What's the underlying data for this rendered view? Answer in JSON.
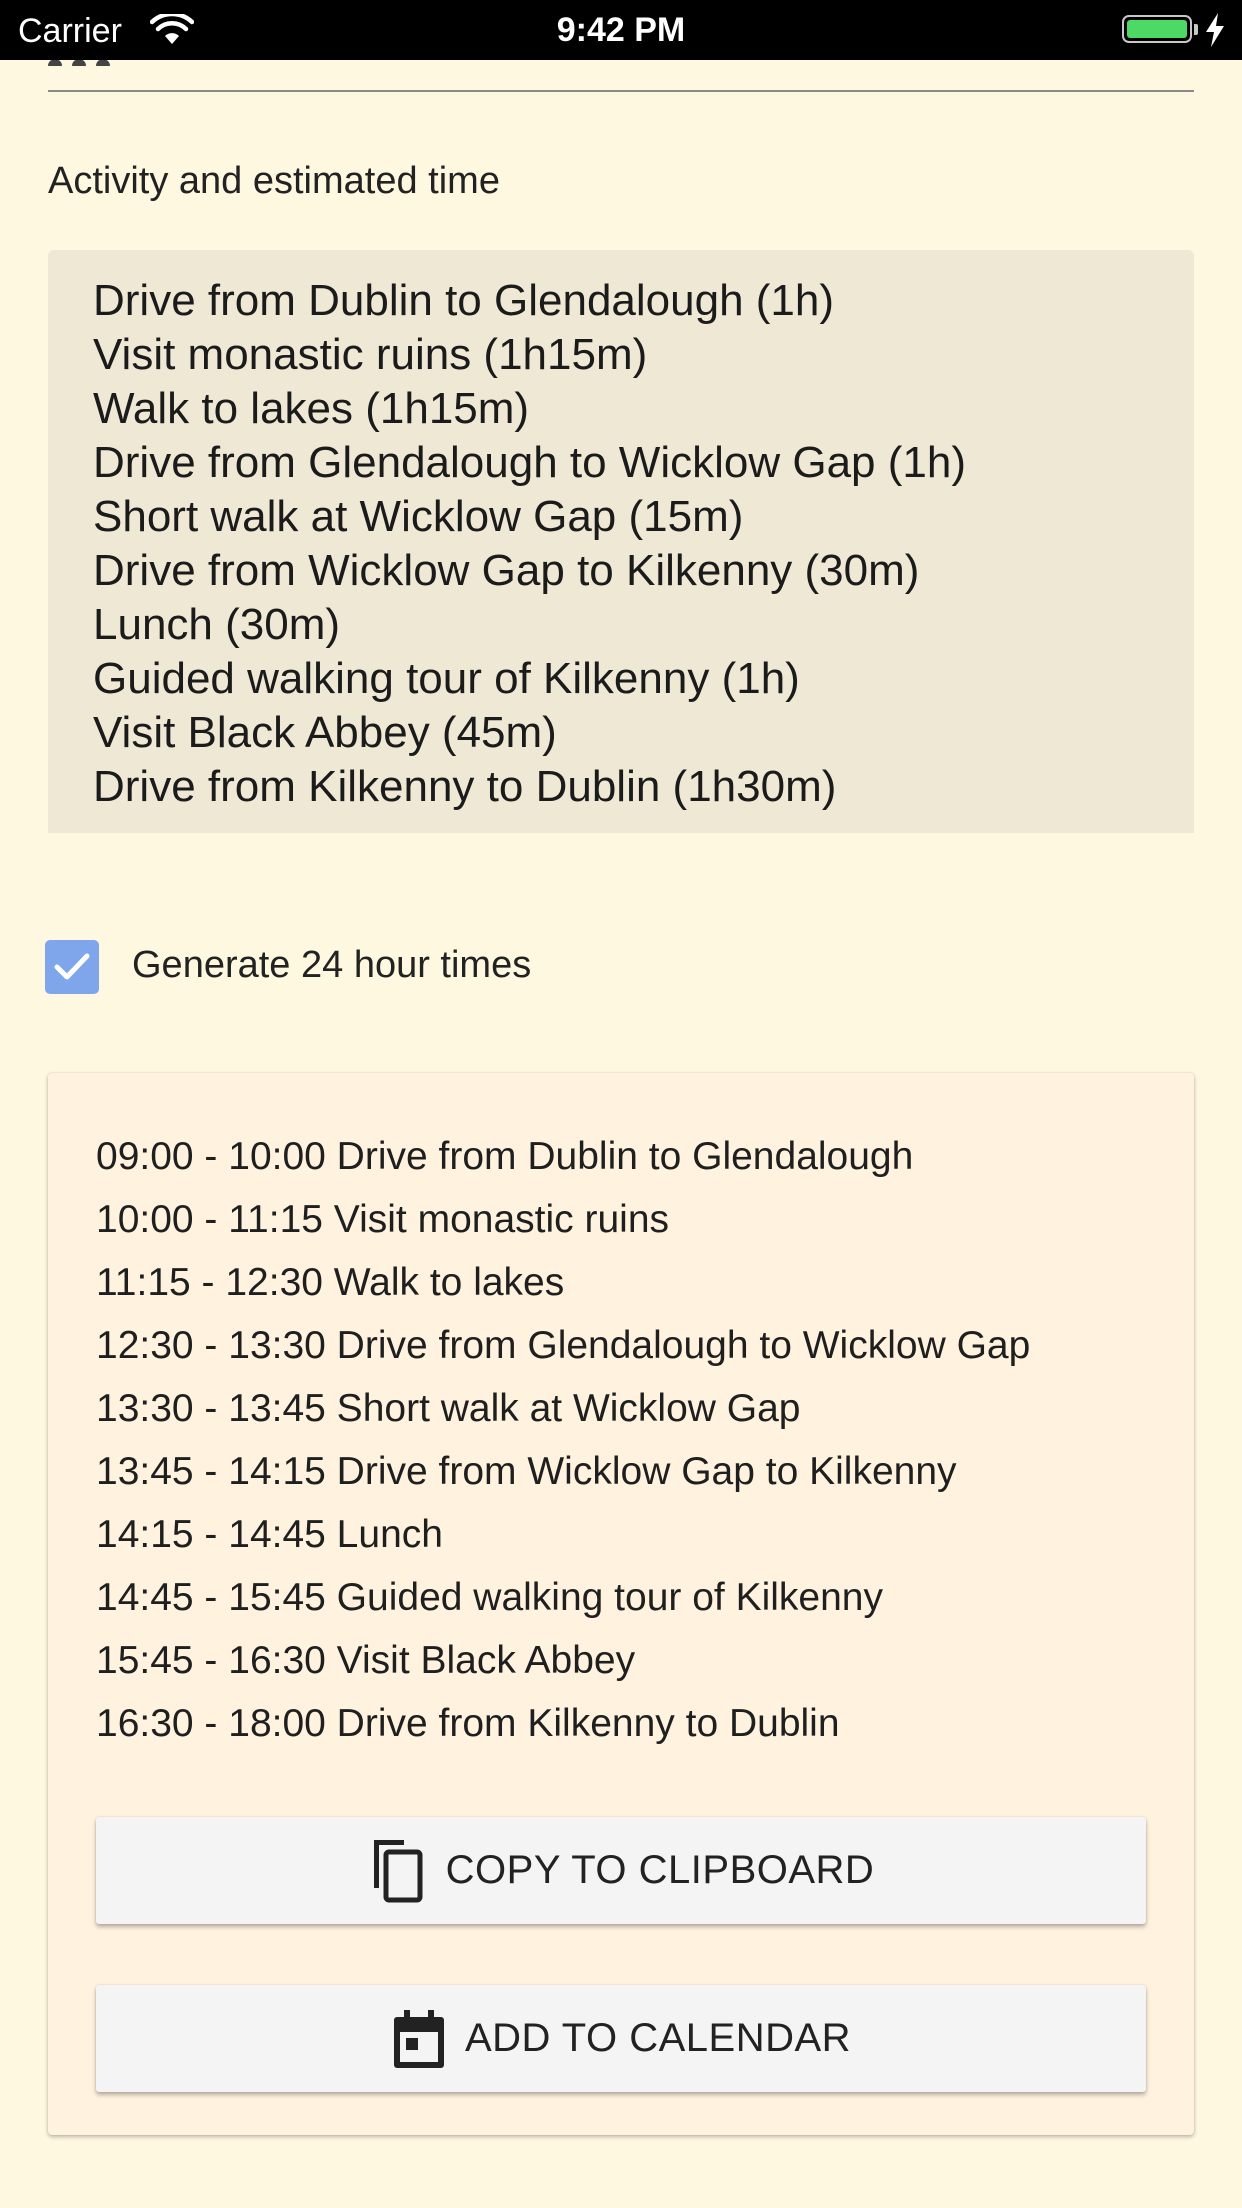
{
  "status_bar": {
    "carrier": "Carrier",
    "time": "9:42 PM",
    "wifi_icon": "wifi-icon",
    "battery_icon": "battery-icon",
    "charging_icon": "bolt-icon",
    "battery_color": "#4cd964"
  },
  "activity": {
    "label": "Activity and estimated time",
    "lines": [
      "Drive from Dublin to Glendalough (1h)",
      "Visit monastic ruins (1h15m)",
      "Walk to lakes (1h15m)",
      "Drive from Glendalough to Wicklow Gap (1h)",
      "Short walk at Wicklow Gap (15m)",
      "Drive from Wicklow Gap to Kilkenny (30m)",
      "Lunch (30m)",
      "Guided walking tour of Kilkenny (1h)",
      "Visit Black Abbey (45m)",
      "Drive from Kilkenny to Dublin (1h30m)"
    ]
  },
  "options": {
    "hour24_label": "Generate 24 hour times",
    "hour24_checked": true,
    "checkbox_color": "#7fa6ea"
  },
  "schedule": {
    "lines": [
      "09:00 - 10:00 Drive from Dublin to Glendalough",
      "10:00 - 11:15 Visit monastic ruins",
      "11:15 - 12:30 Walk to lakes",
      "12:30 - 13:30 Drive from Glendalough to Wicklow Gap",
      "13:30 - 13:45 Short walk at Wicklow Gap",
      "13:45 - 14:15 Drive from Wicklow Gap to Kilkenny",
      "14:15 - 14:45 Lunch",
      "14:45 - 15:45 Guided walking tour of Kilkenny",
      "15:45 - 16:30 Visit Black Abbey",
      "16:30 - 18:00 Drive from Kilkenny to Dublin"
    ]
  },
  "actions": {
    "copy_label": "COPY TO CLIPBOARD",
    "copy_icon": "content-copy-icon",
    "calendar_label": "ADD TO CALENDAR",
    "calendar_icon": "calendar-icon"
  },
  "colors": {
    "page_background": "#fff8e1",
    "input_background": "#eee8d5",
    "card_background": "#fff2df",
    "button_background": "#f4f4f4"
  }
}
